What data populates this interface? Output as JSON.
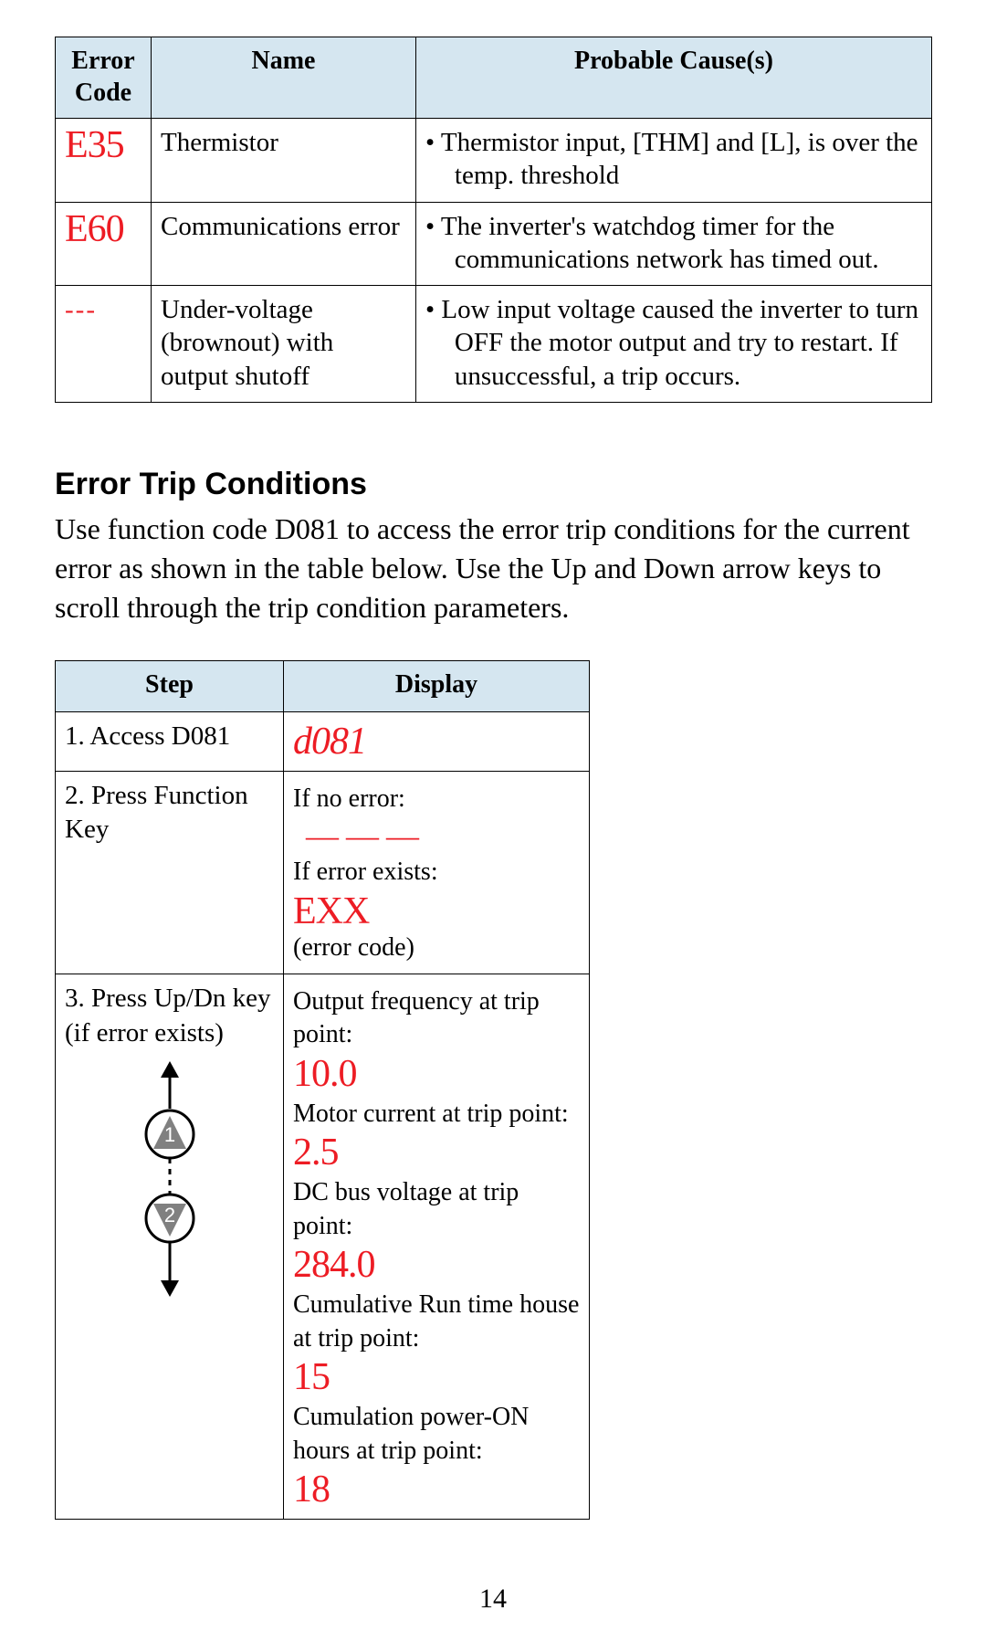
{
  "error_table": {
    "headers": {
      "code": "Error Code",
      "name": "Name",
      "cause": "Probable Cause(s)"
    },
    "rows": [
      {
        "code": "E35",
        "name": "Thermistor",
        "cause": "•  Thermistor input, [THM] and [L], is over the temp. threshold"
      },
      {
        "code": "E60",
        "name": "Communications error",
        "cause": "•  The inverter's watchdog timer for the communications network has timed out."
      },
      {
        "code": "---",
        "name": "Under-voltage (brownout) with output shutoff",
        "cause": "•  Low input voltage caused the inverter to turn OFF the motor output and try to restart. If unsuccessful, a trip occurs."
      }
    ]
  },
  "section_title": "Error Trip Conditions",
  "section_body": "Use function code D081 to access the error trip conditions for the current error as shown in the table below. Use the Up and Down arrow keys to scroll through the trip condition parameters.",
  "trip_table": {
    "headers": {
      "step": "Step",
      "display": "Display"
    },
    "rows": {
      "r1": {
        "step": "1. Access D081",
        "disp_seg": "d081"
      },
      "r2": {
        "step": "2. Press Function Key",
        "lbl_noerr": "If no error:",
        "seg_dashes": "———",
        "lbl_err": "If error exists:",
        "seg_exx": "EXX",
        "subnote": "(error code)"
      },
      "r3": {
        "step": "3. Press Up/Dn key (if error exists)",
        "btn1": "1",
        "btn2": "2",
        "items": [
          {
            "lbl": "Output frequency at trip point:",
            "val": "10.0"
          },
          {
            "lbl": "Motor current at trip point:",
            "val": "2.5"
          },
          {
            "lbl": "DC bus voltage at trip point:",
            "val": "284.0"
          },
          {
            "lbl": "Cumulative Run time house at trip point:",
            "val": "15"
          },
          {
            "lbl": "Cumulation power-ON hours at trip point:",
            "val": "18"
          }
        ]
      }
    }
  },
  "page_number": "14"
}
